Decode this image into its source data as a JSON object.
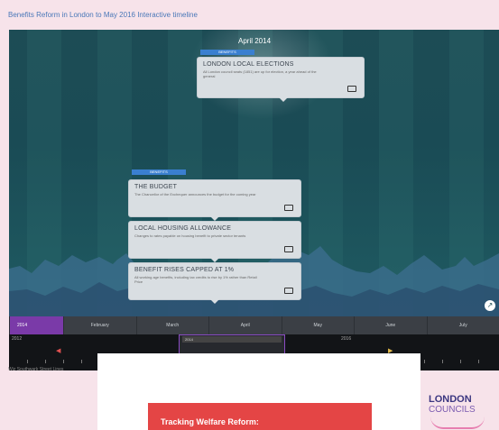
{
  "page": {
    "title": "Benefits Reform in London to May 2016 Interactive timeline",
    "credit": "Wiz Southwark Street Lines"
  },
  "timeline": {
    "current_month": "April 2014",
    "events": [
      {
        "tag": "BENEFITS",
        "title": "LONDON LOCAL ELECTIONS",
        "description": "All London council seats (1851) are up for election, a year ahead of the general"
      },
      {
        "tag": "BENEFITS",
        "title": "THE BUDGET",
        "description": "The Chancellor of the Exchequer announces the budget for the coming year"
      },
      {
        "title": "LOCAL HOUSING ALLOWANCE",
        "description": "Changes to rates payable on housing benefit to private sector tenants"
      },
      {
        "title": "BENEFIT RISES CAPPED AT 1%",
        "description": "All working age benefits, including tax credits to rise by 1% rather than Retail Price"
      }
    ],
    "months": [
      "2014",
      "February",
      "March",
      "April",
      "May",
      "June",
      "July"
    ],
    "years": [
      "2012",
      "2014",
      "2016"
    ],
    "range_label": "2014"
  },
  "banner": {
    "title": "Tracking Welfare Reform:"
  },
  "logo": {
    "line1": "LONDON",
    "line2": "COUNCILS"
  },
  "icons": {
    "expand": "expand-icon",
    "card": "card-icon"
  },
  "colors": {
    "accent_purple": "#7a3aa8",
    "tag_blue": "#3a7fd0",
    "banner_red": "#e44545",
    "timeline_bg": "#1c4a53"
  }
}
